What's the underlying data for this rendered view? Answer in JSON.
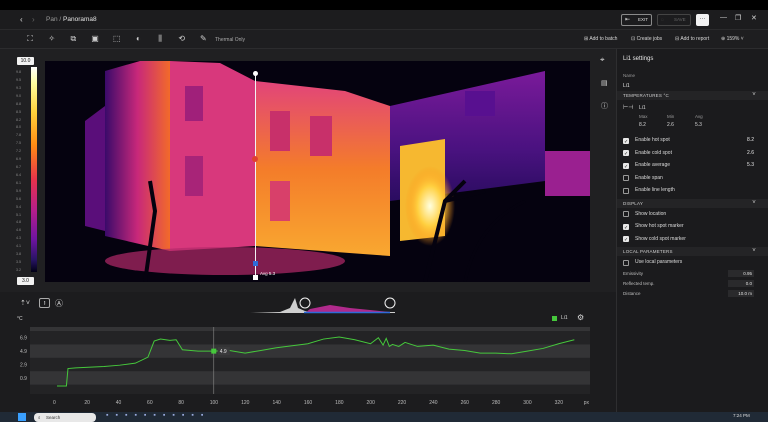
{
  "breadcrumb": {
    "parent": "Pan",
    "separator": "/",
    "current": "Panorama8"
  },
  "titlebar": {
    "exit_label": "EXIT",
    "save_label": "SAVE",
    "more_label": "···"
  },
  "toolbar": {
    "mode_label": "Thermal Only",
    "add_to_batch": "Add to batch",
    "create_jobs": "Create jobs",
    "add_to_report": "Add to report",
    "zoom": "159%"
  },
  "scale": {
    "max": "10.0",
    "min": "3.0",
    "ticks": [
      "9.8",
      "9.5",
      "9.3",
      "9.0",
      "8.8",
      "8.5",
      "8.2",
      "8.0",
      "7.8",
      "7.5",
      "7.2",
      "6.9",
      "6.7",
      "6.4",
      "6.1",
      "5.9",
      "5.6",
      "5.4",
      "5.1",
      "4.8",
      "4.6",
      "4.3",
      "4.1",
      "3.8",
      "3.5",
      "3.2"
    ]
  },
  "measurement": {
    "cursor_label": "Avg 5.3"
  },
  "panel": {
    "title": "Li1 settings",
    "name_label": "Name",
    "name_value": "Li1",
    "temps_header": "TEMPERATURES °C",
    "li_label": "Li1",
    "stats_headers": [
      "Max",
      "Min",
      "Avg"
    ],
    "stats_values": [
      "8.2",
      "2.6",
      "5.3"
    ],
    "options": [
      {
        "label": "Enable hot spot",
        "checked": true,
        "value": "8.2"
      },
      {
        "label": "Enable cold spot",
        "checked": true,
        "value": "2.6"
      },
      {
        "label": "Enable average",
        "checked": true,
        "value": "5.3"
      },
      {
        "label": "Enable span",
        "checked": false,
        "value": ""
      },
      {
        "label": "Enable line length",
        "checked": false,
        "value": ""
      }
    ],
    "display_header": "DISPLAY",
    "display_options": [
      {
        "label": "Show location",
        "checked": false
      },
      {
        "label": "Show hot spot marker",
        "checked": true
      },
      {
        "label": "Show cold spot marker",
        "checked": true
      }
    ],
    "local_header": "LOCAL PARAMETERS",
    "use_local": "Use local parameters",
    "params": [
      {
        "label": "Emissivity",
        "value": "0.95"
      },
      {
        "label": "Reflected temp.",
        "value": "0.0"
      },
      {
        "label": "Distance",
        "value": "10.0 m"
      }
    ]
  },
  "profile": {
    "unit_label": "°C",
    "legend_label": "Li1",
    "cursor_value": "4.9",
    "x_unit": "px"
  },
  "taskbar": {
    "search_placeholder": "Search",
    "time": "7:24 PM"
  },
  "colors": {
    "accent": "#2f6bd8",
    "series": "#46c83c",
    "panel_bg": "#1b1b1d"
  },
  "chart_data": {
    "type": "line",
    "title": "",
    "xlabel": "px",
    "ylabel": "°C",
    "xlim": [
      0,
      340
    ],
    "ylim": [
      -1.5,
      8.5
    ],
    "x_ticks": [
      0,
      20,
      40,
      60,
      80,
      100,
      120,
      140,
      160,
      180,
      200,
      220,
      240,
      260,
      280,
      300,
      320,
      340
    ],
    "y_ticks": [
      0.9,
      2.9,
      4.9,
      6.9
    ],
    "series": [
      {
        "name": "Li1",
        "x": [
          0,
          6,
          7,
          12,
          20,
          30,
          40,
          50,
          58,
          62,
          66,
          72,
          76,
          80,
          90,
          100,
          110,
          120,
          130,
          140,
          150,
          160,
          170,
          180,
          190,
          200,
          205,
          208,
          210,
          212,
          214,
          218,
          222,
          230,
          240,
          250,
          260,
          270,
          280,
          290,
          300,
          310,
          320,
          330
        ],
        "y": [
          -0.3,
          -0.3,
          2.3,
          2.4,
          2.5,
          2.6,
          2.8,
          3.1,
          4.0,
          6.4,
          6.7,
          6.5,
          6.6,
          5.1,
          4.9,
          4.9,
          5.0,
          4.6,
          5.0,
          5.4,
          5.7,
          6.0,
          6.7,
          7.0,
          6.6,
          6.0,
          6.9,
          5.8,
          6.8,
          5.6,
          5.9,
          5.6,
          6.2,
          5.6,
          5.8,
          5.2,
          5.0,
          4.6,
          4.6,
          4.5,
          4.9,
          5.3,
          6.0,
          6.6
        ]
      }
    ]
  }
}
